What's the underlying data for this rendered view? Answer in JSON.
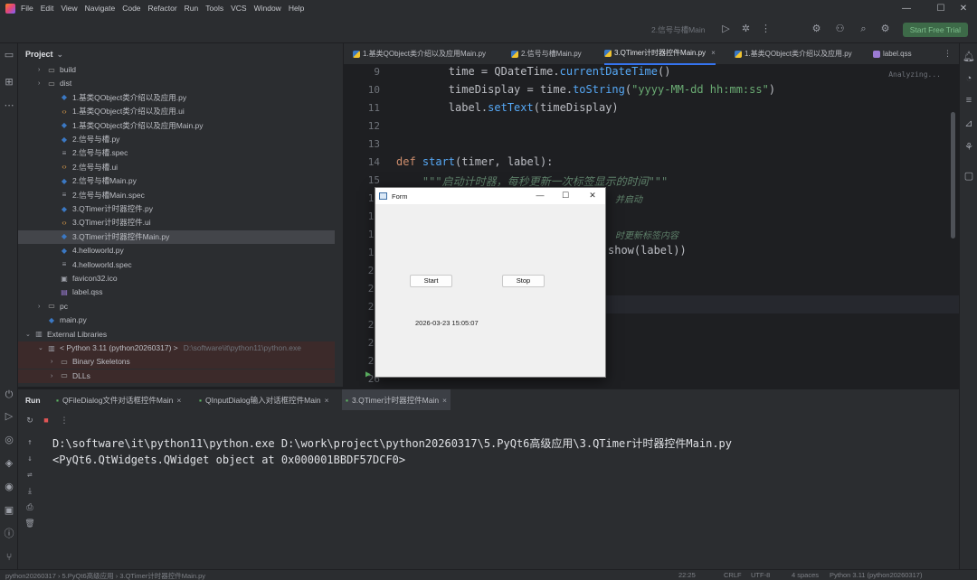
{
  "titlebar": {
    "menu": [
      "File",
      "Edit",
      "View",
      "Navigate",
      "Code",
      "Refactor",
      "Run",
      "Tools",
      "VCS",
      "Window",
      "Help"
    ],
    "run_config": "2.信号与槽Main",
    "start_trial": "Start Free Trial",
    "minimize": "—",
    "maximize": "☐",
    "close": "✕"
  },
  "project_panel": {
    "title": "Project",
    "items": [
      {
        "label": "build",
        "type": "folder",
        "indent": 1,
        "arrow": "›"
      },
      {
        "label": "dist",
        "type": "folder",
        "indent": 1,
        "arrow": "›"
      },
      {
        "label": "1.基类QObject类介绍以及应用.py",
        "type": "py",
        "indent": 2
      },
      {
        "label": "1.基类QObject类介绍以及应用.ui",
        "type": "ui",
        "indent": 2
      },
      {
        "label": "1.基类QObject类介绍以及应用Main.py",
        "type": "py",
        "indent": 2
      },
      {
        "label": "2.信号与槽.py",
        "type": "py",
        "indent": 2
      },
      {
        "label": "2.信号与槽.spec",
        "type": "spec",
        "indent": 2
      },
      {
        "label": "2.信号与槽.ui",
        "type": "ui",
        "indent": 2
      },
      {
        "label": "2.信号与槽Main.py",
        "type": "py",
        "indent": 2
      },
      {
        "label": "2.信号与槽Main.spec",
        "type": "spec",
        "indent": 2
      },
      {
        "label": "3.QTimer计时器控件.py",
        "type": "py",
        "indent": 2
      },
      {
        "label": "3.QTimer计时器控件.ui",
        "type": "ui",
        "indent": 2
      },
      {
        "label": "3.QTimer计时器控件Main.py",
        "type": "py",
        "indent": 2,
        "selected": true
      },
      {
        "label": "4.helloworld.py",
        "type": "py",
        "indent": 2
      },
      {
        "label": "4.helloworld.spec",
        "type": "spec",
        "indent": 2
      },
      {
        "label": "favicon32.ico",
        "type": "ico",
        "indent": 2
      },
      {
        "label": "label.qss",
        "type": "qss",
        "indent": 2
      },
      {
        "label": "pc",
        "type": "folder",
        "indent": 1,
        "arrow": "›"
      },
      {
        "label": "main.py",
        "type": "py",
        "indent": 1
      },
      {
        "label": "External Libraries",
        "type": "lib",
        "indent": 0,
        "arrow": "⌄"
      },
      {
        "label": "< Python 3.11 (python20260317) >",
        "type": "lib",
        "indent": 1,
        "arrow": "⌄",
        "hint": "D:\\software\\it\\python11\\python.exe",
        "ext": true
      },
      {
        "label": "Binary Skeletons",
        "type": "folder",
        "indent": 2,
        "arrow": "›",
        "ext": true
      },
      {
        "label": "DLLs",
        "type": "folder",
        "indent": 2,
        "arrow": "›",
        "ext": true
      }
    ]
  },
  "editor_tabs": [
    {
      "label": "1.基类QObject类介绍以及应用Main.py"
    },
    {
      "label": "2.信号与槽Main.py"
    },
    {
      "label": "3.QTimer计时器控件Main.py",
      "active": true,
      "close": "×"
    },
    {
      "label": "1.基类QObject类介绍以及应用.py"
    },
    {
      "label": "label.qss"
    }
  ],
  "editor": {
    "status": "Analyzing...",
    "line_numbers": [
      "9",
      "10",
      "11",
      "12",
      "13",
      "14",
      "15",
      "16",
      "17",
      "18",
      "19",
      "20",
      "21",
      "22",
      "23",
      "24",
      "25",
      "26"
    ],
    "lines": {
      "l9_indent": "        ",
      "l9_a": "time = QDateTime.",
      "l9_fn": "currentDateTime",
      "l9_b": "()",
      "l10_a": "        timeDisplay = time.",
      "l10_fn": "toString",
      "l10_b": "(",
      "l10_str": "\"yyyy-MM-dd hh:mm:ss\"",
      "l10_c": ")",
      "l11_a": "        label.",
      "l11_fn": "setText",
      "l11_b": "(timeDisplay)",
      "l14_kw": "def ",
      "l14_fn": "start",
      "l14_b": "(timer, label):",
      "l15_doc": "    \"\"\"启动计时器，每秒更新一次标签显示的时间\"\"\"",
      "l16_tail": "并启动",
      "l18_tail": "时更新标签内容",
      "l19_tail": "show(label))"
    }
  },
  "qt_form": {
    "title": "Form",
    "minimize": "—",
    "maximize": "☐",
    "close": "✕",
    "start_button": "Start",
    "stop_button": "Stop",
    "time_label": "2026-03-23 15:05:07"
  },
  "run_panel": {
    "title": "Run",
    "tabs": [
      {
        "label": "QFileDialog文件对话框控件Main"
      },
      {
        "label": "QInputDialog输入对话框控件Main"
      },
      {
        "label": "3.QTimer计时器控件Main",
        "active": true
      }
    ],
    "close": "×",
    "console_lines": [
      "D:\\software\\it\\python11\\python.exe D:\\work\\project\\python20260317\\5.PyQt6高级应用\\3.QTimer计时器控件Main.py",
      "<PyQt6.QtWidgets.QWidget object at 0x000001BBDF57DCF0>"
    ]
  },
  "statusbar": {
    "path": "python20260317 › 5.PyQt6高级应用 › 3.QTimer计时器控件Main.py",
    "position": "22:25",
    "line_sep": "CRLF",
    "encoding": "UTF-8",
    "indent": "4 spaces",
    "interpreter": "Python 3.11 (python20260317)"
  },
  "colors": {
    "background": "#1e1f22",
    "panel": "#2b2d30",
    "keyword": "#cf8e6d",
    "function": "#56a8f5",
    "string": "#6aab73",
    "docstring": "#5f826b",
    "accent": "#3574f0"
  }
}
